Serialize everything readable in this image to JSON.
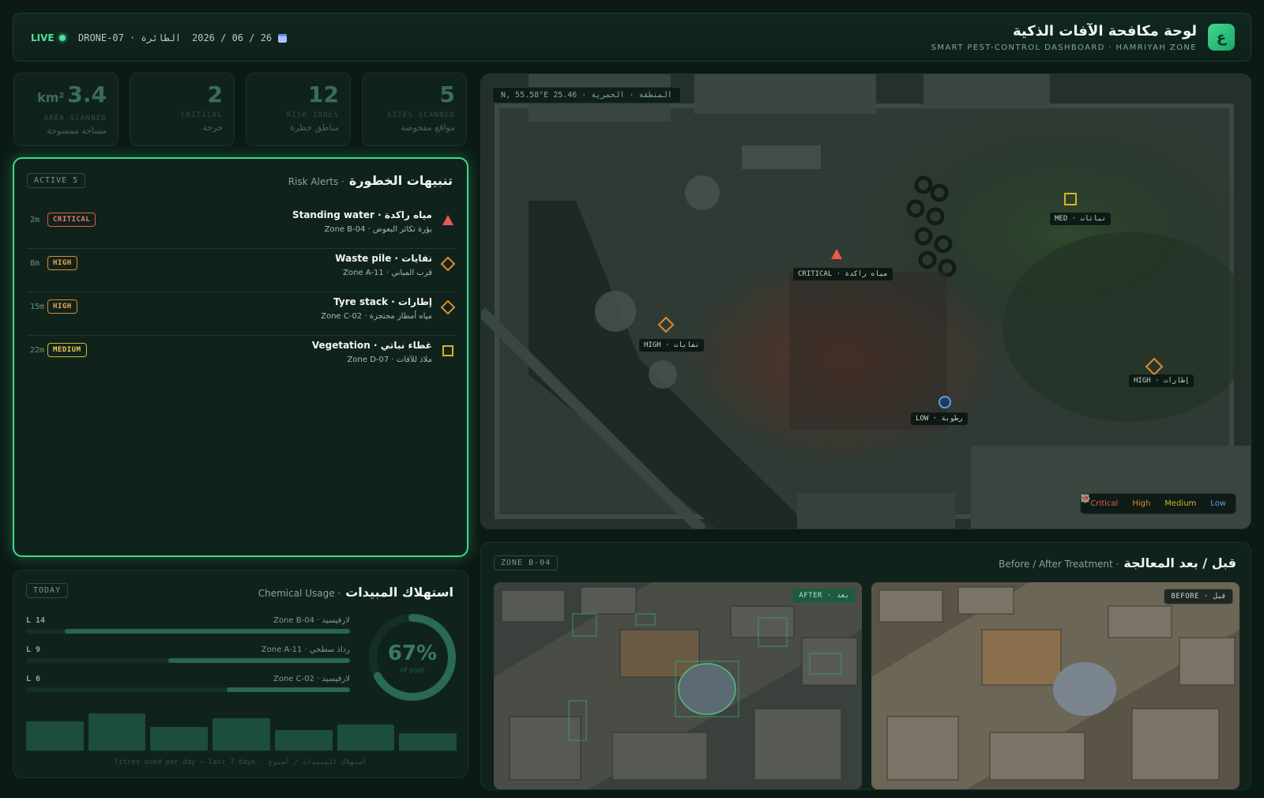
{
  "header": {
    "live": "LIVE",
    "drone": "DRONE-07 · الطائرة",
    "date": "2026 / 06 / 26",
    "title_ar": "لوحة مكافحة الآفات الذكية",
    "title_en": "SMART PEST-CONTROL DASHBOARD · HAMRIYAH ZONE",
    "logo": "ع"
  },
  "stats": [
    {
      "value": "5",
      "unit": "",
      "en": "SITES SCANNED",
      "ar": "مواقع مفحوصة"
    },
    {
      "value": "12",
      "unit": "",
      "en": "RISK ZONES",
      "ar": "مناطق خطرة"
    },
    {
      "value": "2",
      "unit": "",
      "en": "CRITICAL",
      "ar": "حرجة"
    },
    {
      "value": "3.4",
      "unit": "km²",
      "en": "AREA SCANNED",
      "ar": "مساحة ممسوحة"
    }
  ],
  "alerts": {
    "chip": "ACTIVE 5",
    "title_ar": "تنبيهات الخطورة",
    "title_en": "Risk Alerts ·",
    "items": [
      {
        "time": "2m",
        "level": "CRITICAL",
        "title": "Standing water · مياه راكدة",
        "sub": "Zone B-04 · بؤرة تكاثر البعوض",
        "icon": "triangle-icon"
      },
      {
        "time": "8m",
        "level": "HIGH",
        "title": "Waste pile · نفايات",
        "sub": "Zone A-11 · قرب المباني",
        "icon": "diamond-icon"
      },
      {
        "time": "15m",
        "level": "HIGH",
        "title": "Tyre stack · إطارات",
        "sub": "Zone C-02 · مياه أمطار محتجزة",
        "icon": "diamond-icon"
      },
      {
        "time": "22m",
        "level": "MEDIUM",
        "title": "Vegetation · غطاء نباتي",
        "sub": "Zone D-07 · ملاذ للآفات",
        "icon": "square-icon"
      }
    ]
  },
  "chemical": {
    "chip": "TODAY",
    "title_ar": "استهلاك المبيدات",
    "title_en": "Chemical Usage ·",
    "rows": [
      {
        "litres": "L 14",
        "zone": "Zone B-04 · لارفيسيد",
        "fraction": 0.88
      },
      {
        "litres": "L 9",
        "zone": "Zone A-11 · رذاذ سطحي",
        "fraction": 0.56
      },
      {
        "litres": "L 6",
        "zone": "Zone C-02 · لارفيسيد",
        "fraction": 0.38
      }
    ],
    "donut_value": "67%",
    "donut_fraction": 0.67,
    "donut_sub": "of plan",
    "daily_bars": [
      0.72,
      0.9,
      0.58,
      0.78,
      0.5,
      0.64,
      0.42
    ],
    "footer": "litres used per day — last 7 days · استهلاك المبيدات / أسبوع"
  },
  "map": {
    "coord": "N, 55.58°E 25.46 · المنطقة · الحمرية",
    "markers": [
      {
        "label": "CRITICAL · مياه راكدة",
        "color": "#e85a4a",
        "icon": "triangle-icon"
      },
      {
        "label": "HIGH · نفايات",
        "color": "#e08a2a",
        "icon": "diamond-icon"
      },
      {
        "label": "MED · نباتات",
        "color": "#d4b42a",
        "icon": "square-icon"
      },
      {
        "label": "HIGH · إطارات",
        "color": "#e08a2a",
        "icon": "diamond-icon"
      },
      {
        "label": "LOW · رطوبة",
        "color": "#5aa0e0",
        "icon": "circle-icon"
      }
    ],
    "legend": [
      {
        "label": "Critical",
        "color": "#e85a4a",
        "icon": "triangle-icon"
      },
      {
        "label": "High",
        "color": "#e08a2a",
        "icon": "diamond-icon"
      },
      {
        "label": "Medium",
        "color": "#d4b42a",
        "icon": "square-icon"
      },
      {
        "label": "Low",
        "color": "#5aa0e0",
        "icon": "circle-icon"
      }
    ]
  },
  "before_after": {
    "chip": "ZONE B-04",
    "title_ar": "قبل / بعد المعالجة",
    "title_en": "Before / After Treatment ·",
    "after_tag": "AFTER · بعد",
    "before_tag": "BEFORE · قبل"
  },
  "colors": {
    "accent": "#3fd98f",
    "critical": "#e85a4a",
    "high": "#e08a2a",
    "medium": "#d4b42a",
    "low": "#5aa0e0"
  }
}
